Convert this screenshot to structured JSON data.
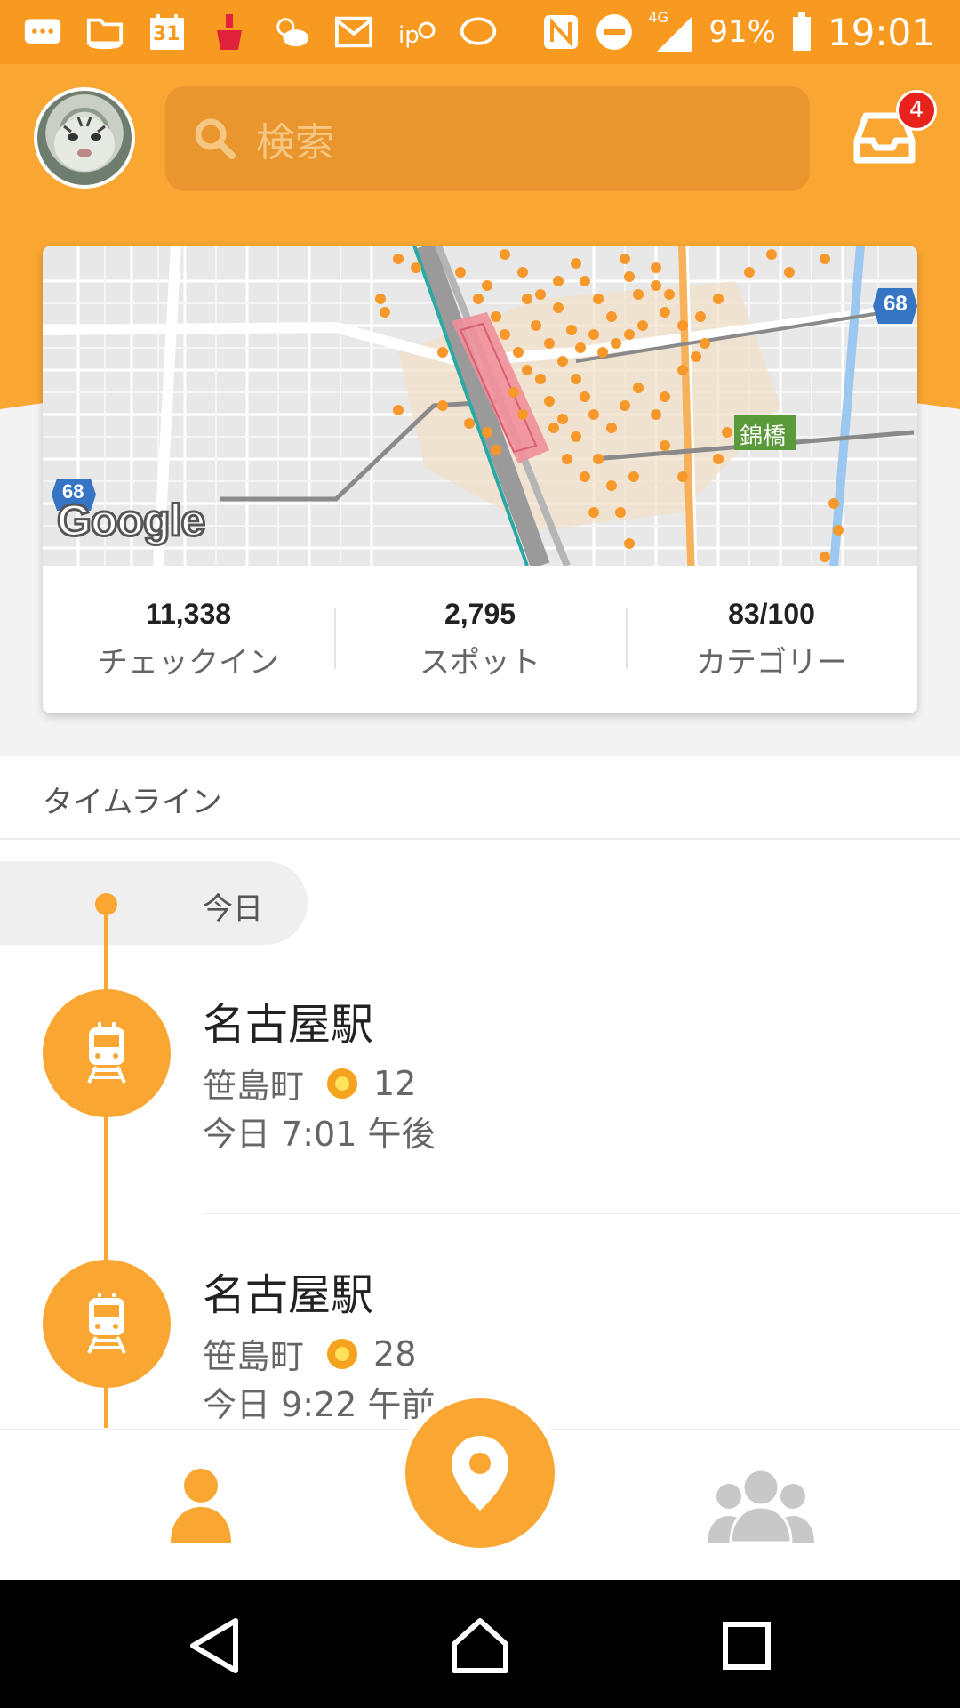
{
  "status_bar": {
    "calendar_day": "31",
    "battery": "91%",
    "time": "19:01",
    "network": "4G"
  },
  "header": {
    "search_placeholder": "検索",
    "inbox_badge": "4"
  },
  "map": {
    "google_logo": "Google",
    "route_68": "68",
    "route_68_left": "68",
    "place_label": "錦橋"
  },
  "stats": [
    {
      "value": "11,338",
      "label": "チェックイン"
    },
    {
      "value": "2,795",
      "label": "スポット"
    },
    {
      "value": "83/100",
      "label": "カテゴリー"
    }
  ],
  "timeline": {
    "title": "タイムライン",
    "today_label": "今日",
    "entries": [
      {
        "name": "名古屋駅",
        "area": "笹島町",
        "coins": "12",
        "time": "今日 7:01 午後"
      },
      {
        "name": "名古屋駅",
        "area": "笹島町",
        "coins": "28",
        "time": "今日 9:22 午前"
      }
    ]
  },
  "colors": {
    "brand_orange": "#faa632",
    "status_orange": "#f89a1f",
    "badge_red": "#e8231e"
  },
  "icons": {
    "search": "search-icon",
    "inbox": "inbox-icon",
    "train": "train-icon",
    "profile": "person-icon",
    "checkin": "location-pin-icon",
    "friends": "friends-icon"
  }
}
